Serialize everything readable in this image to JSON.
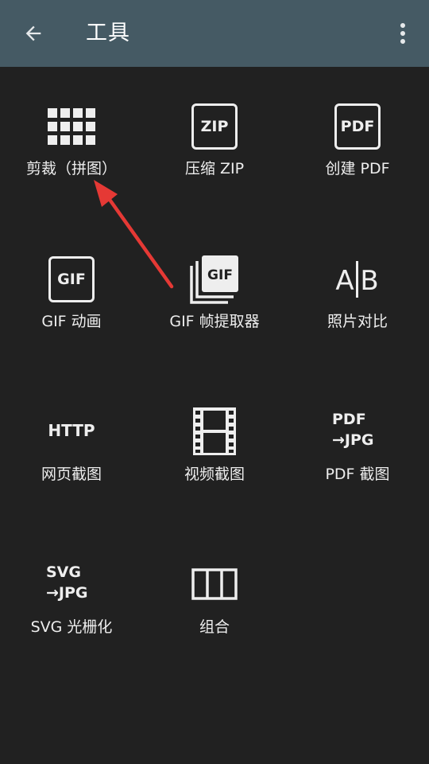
{
  "appbar": {
    "title": "工具",
    "back_icon": "arrow-left-icon",
    "more_icon": "more-vertical-icon"
  },
  "colors": {
    "appbar": "#455a64",
    "background": "#212121",
    "foreground": "#eeeeee",
    "annotation_arrow": "#e53935"
  },
  "tools": [
    {
      "id": "crop-stitch",
      "label": "剪裁（拼图）",
      "icon": "grid-icon"
    },
    {
      "id": "compress-zip",
      "label": "压缩 ZIP",
      "icon": "zip-icon",
      "icon_text": "ZIP"
    },
    {
      "id": "create-pdf",
      "label": "创建 PDF",
      "icon": "pdf-icon",
      "icon_text": "PDF"
    },
    {
      "id": "gif-animation",
      "label": "GIF 动画",
      "icon": "gif-icon",
      "icon_text": "GIF"
    },
    {
      "id": "gif-frame-extractor",
      "label": "GIF 帧提取器",
      "icon": "gif-stack-icon",
      "icon_text": "GIF"
    },
    {
      "id": "photo-compare",
      "label": "照片对比",
      "icon": "a-b-compare-icon",
      "icon_text_a": "A",
      "icon_text_b": "B"
    },
    {
      "id": "webpage-screenshot",
      "label": "网页截图",
      "icon": "http-icon",
      "icon_text": "HTTP"
    },
    {
      "id": "video-screenshot",
      "label": "视频截图",
      "icon": "film-strip-icon"
    },
    {
      "id": "pdf-screenshot",
      "label": "PDF 截图",
      "icon": "pdf-to-jpg-icon",
      "icon_line1": "PDF",
      "icon_line2": "→JPG"
    },
    {
      "id": "svg-rasterize",
      "label": "SVG 光栅化",
      "icon": "svg-to-jpg-icon",
      "icon_line1": "SVG",
      "icon_line2": "→JPG"
    },
    {
      "id": "combine",
      "label": "组合",
      "icon": "columns-icon"
    }
  ]
}
